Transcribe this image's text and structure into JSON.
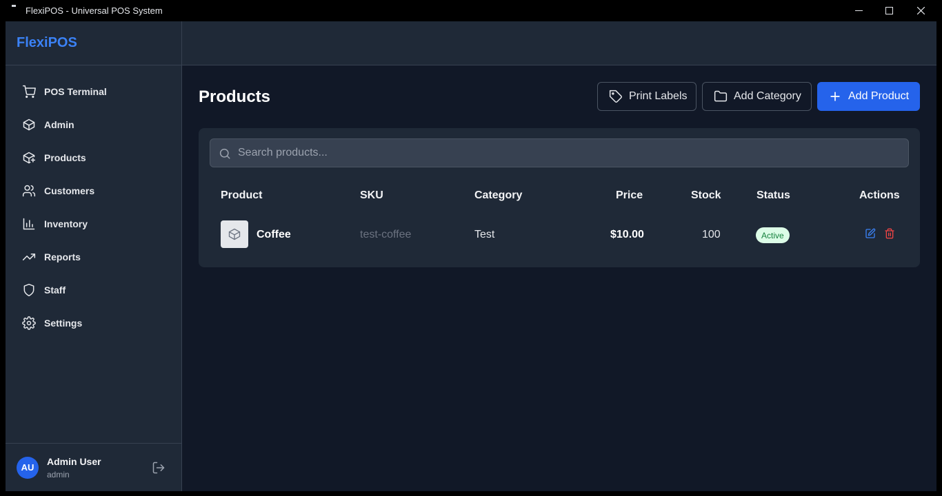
{
  "window": {
    "title": "FlexiPOS - Universal POS System"
  },
  "sidebar": {
    "brand": "FlexiPOS",
    "items": [
      {
        "label": "POS Terminal",
        "icon": "cart-icon"
      },
      {
        "label": "Admin",
        "icon": "package-icon"
      },
      {
        "label": "Products",
        "icon": "package-plus-icon"
      },
      {
        "label": "Customers",
        "icon": "users-icon"
      },
      {
        "label": "Inventory",
        "icon": "bar-chart-icon"
      },
      {
        "label": "Reports",
        "icon": "trending-up-icon"
      },
      {
        "label": "Staff",
        "icon": "shield-icon"
      },
      {
        "label": "Settings",
        "icon": "gear-icon"
      }
    ],
    "user": {
      "initials": "AU",
      "name": "Admin User",
      "role": "admin"
    }
  },
  "page": {
    "title": "Products",
    "buttons": {
      "print_labels": "Print Labels",
      "add_category": "Add Category",
      "add_product": "Add Product"
    },
    "search": {
      "placeholder": "Search products..."
    },
    "table": {
      "headers": [
        "Product",
        "SKU",
        "Category",
        "Price",
        "Stock",
        "Status",
        "Actions"
      ],
      "rows": [
        {
          "product": "Coffee",
          "sku": "test-coffee",
          "category": "Test",
          "price": "$10.00",
          "stock": "100",
          "status": "Active"
        }
      ]
    }
  },
  "colors": {
    "accent": "#2563eb",
    "brand": "#3b82f6",
    "status_active_bg": "#dcfce7",
    "status_active_text": "#15803d",
    "edit": "#3b82f6",
    "delete": "#ef4444"
  }
}
